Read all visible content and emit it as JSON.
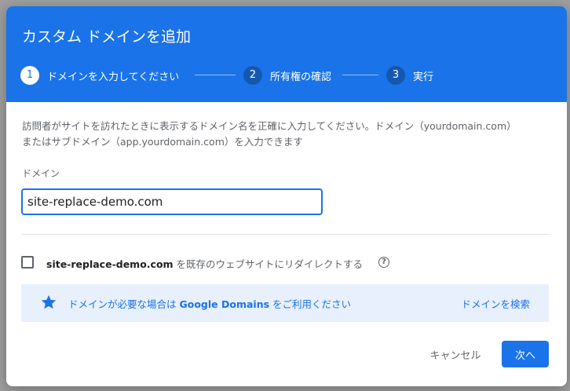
{
  "dialog": {
    "title": "カスタム ドメインを追加"
  },
  "steps": [
    {
      "number": "1",
      "label": "ドメインを入力してください"
    },
    {
      "number": "2",
      "label": "所有権の確認"
    },
    {
      "number": "3",
      "label": "実行"
    }
  ],
  "description": "訪問者がサイトを訪れたときに表示するドメイン名を正確に入力してください。ドメイン（yourdomain.com）またはサブドメイン（app.yourdomain.com）を入力できます",
  "domain_field": {
    "label": "ドメイン",
    "value": "site-replace-demo.com"
  },
  "redirect": {
    "domain": "site-replace-demo.com",
    "suffix": " を既存のウェブサイトにリダイレクトする",
    "help_icon": "question-circle-icon"
  },
  "promo": {
    "icon": "star-icon",
    "text_prefix": "ドメインが必要な場合は ",
    "brand": "Google Domains",
    "text_suffix": " をご利用ください",
    "link": "ドメインを検索"
  },
  "actions": {
    "cancel_label": "キャンセル",
    "next_label": "次へ"
  },
  "colors": {
    "primary": "#1a73e8",
    "promo_bg": "#e8f0fe"
  }
}
